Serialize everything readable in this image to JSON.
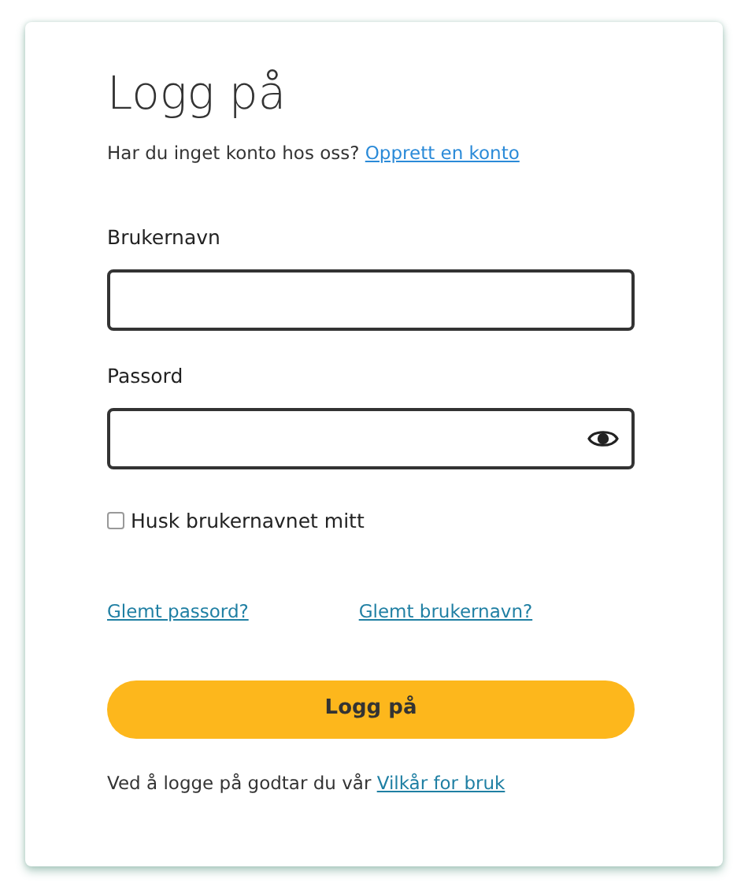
{
  "title": "Logg på",
  "signup_prompt": {
    "text": "Har du inget konto hos oss?",
    "link": "Opprett en konto"
  },
  "fields": [
    {
      "label": "Brukernavn",
      "kind": "text"
    },
    {
      "label": "Passord",
      "kind": "password"
    }
  ],
  "remember": {
    "label": "Husk brukernavnet mitt",
    "checked": false
  },
  "help_links": [
    "Glemt passord?",
    "Glemt brukernavn?"
  ],
  "submit": "Logg på",
  "terms": {
    "text": "Ved å logge på godtar du vår",
    "link": "Vilkår for bruk"
  }
}
